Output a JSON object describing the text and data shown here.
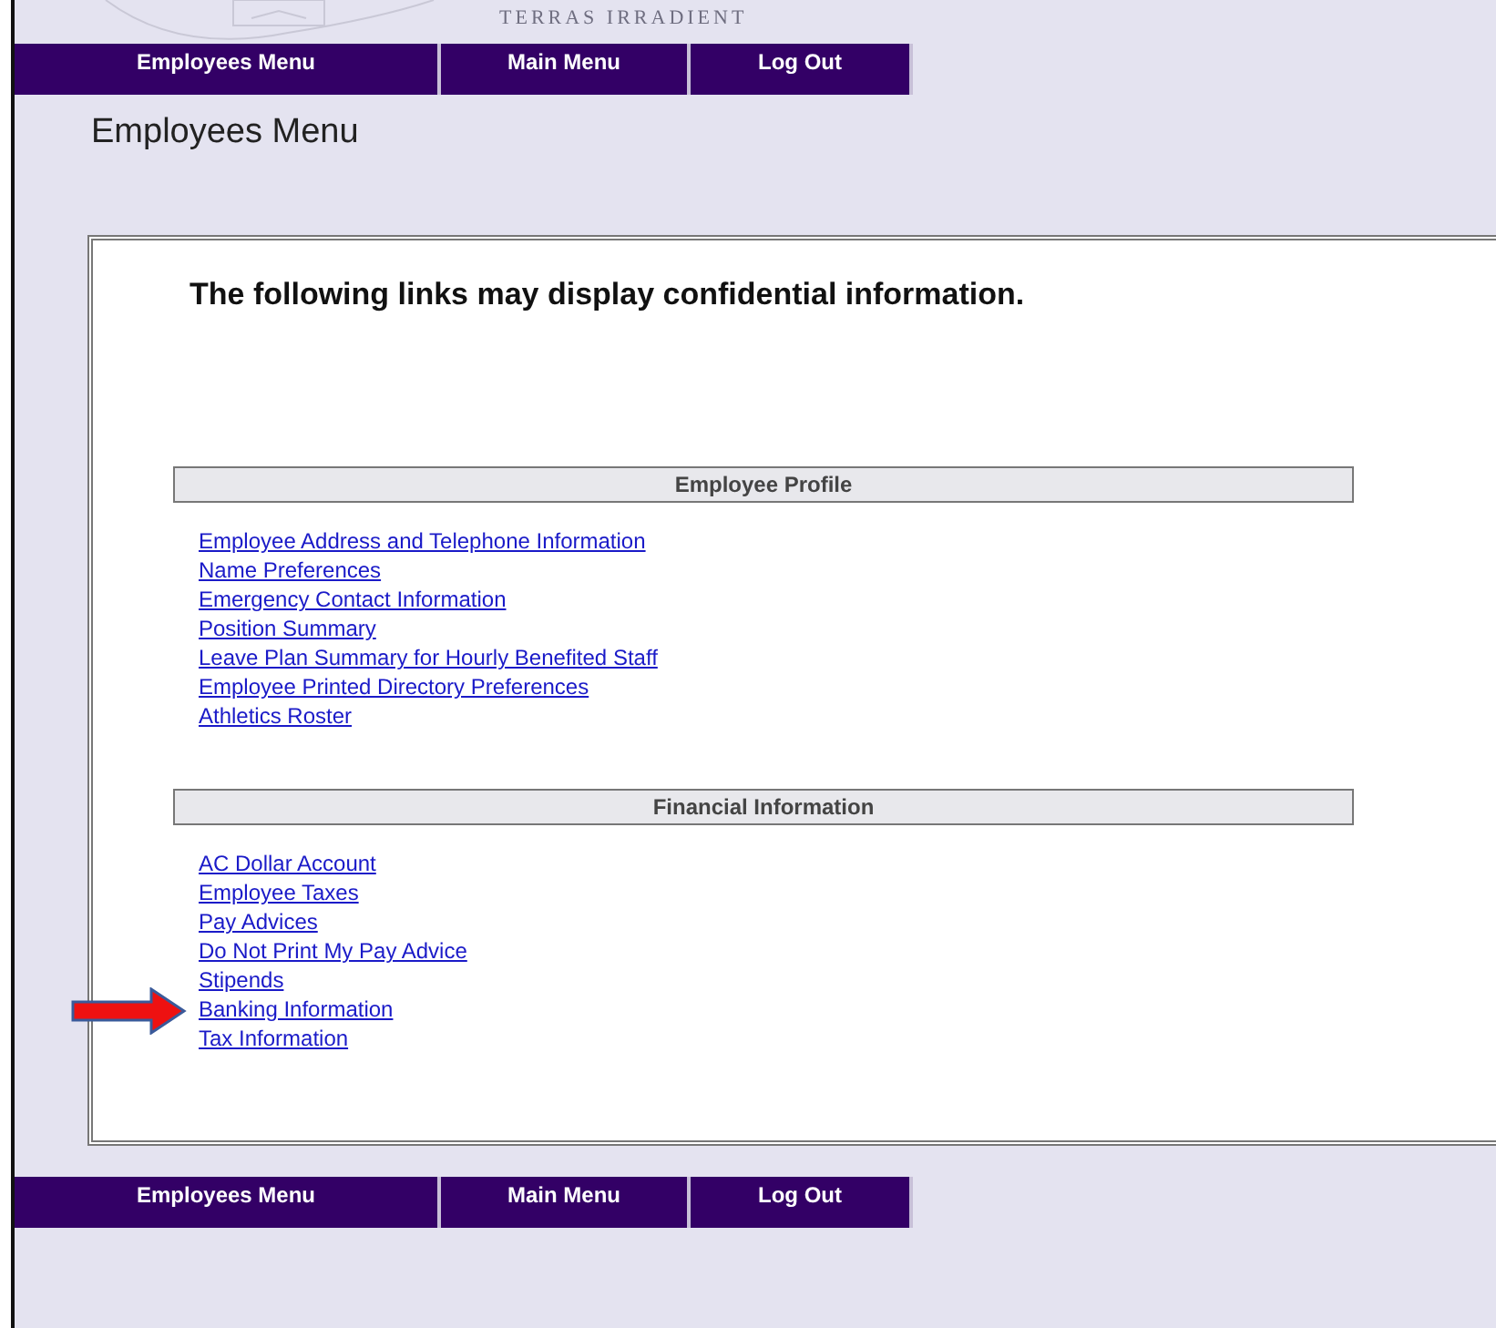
{
  "header": {
    "motto": "TERRAS IRRADIENT"
  },
  "top_nav": [
    {
      "label": "Employees Menu"
    },
    {
      "label": "Main Menu"
    },
    {
      "label": "Log Out"
    }
  ],
  "page_title": "Employees Menu",
  "notice": "The following links may display confidential information.",
  "sections": [
    {
      "title": "Employee Profile",
      "links": [
        {
          "label": "Employee Address and Telephone Information",
          "arrow": false
        },
        {
          "label": "Name Preferences",
          "arrow": false
        },
        {
          "label": "Emergency Contact Information",
          "arrow": false
        },
        {
          "label": "Position Summary",
          "arrow": false
        },
        {
          "label": "Leave Plan Summary for Hourly Benefited Staff",
          "arrow": false
        },
        {
          "label": "Employee Printed Directory Preferences",
          "arrow": false
        },
        {
          "label": "Athletics Roster",
          "arrow": false
        }
      ]
    },
    {
      "title": "Financial Information",
      "links": [
        {
          "label": "AC Dollar Account",
          "arrow": false
        },
        {
          "label": "Employee Taxes",
          "arrow": false
        },
        {
          "label": "Pay Advices",
          "arrow": false
        },
        {
          "label": "Do Not Print My Pay Advice",
          "arrow": false
        },
        {
          "label": "Stipends",
          "arrow": false
        },
        {
          "label": "Banking Information",
          "arrow": true
        },
        {
          "label": "Tax Information",
          "arrow": false
        }
      ]
    }
  ],
  "bottom_nav": [
    {
      "label": "Employees Menu"
    },
    {
      "label": "Main Menu"
    },
    {
      "label": "Log Out"
    }
  ]
}
